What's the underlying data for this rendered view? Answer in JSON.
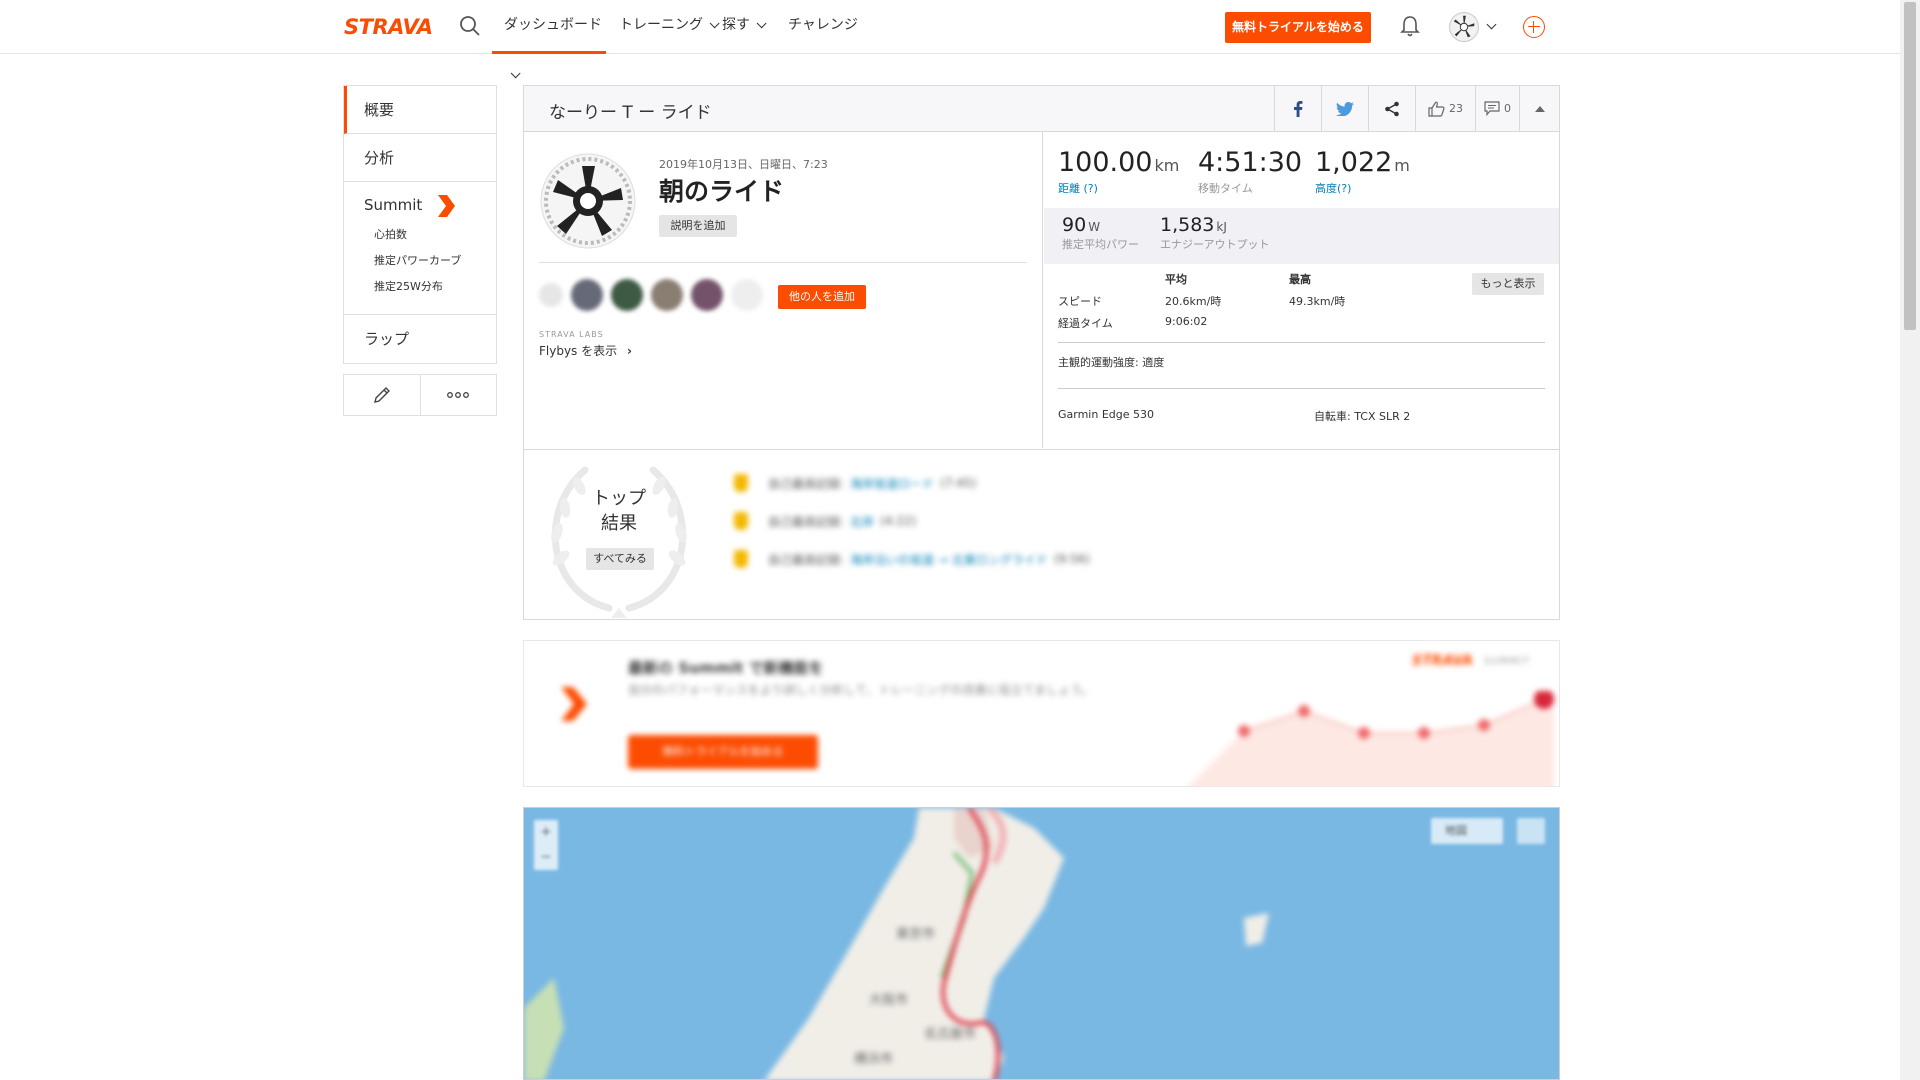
{
  "nav": {
    "logo": "STRAVA",
    "items": [
      {
        "label": "ダッシュボード"
      },
      {
        "label": "トレーニング"
      },
      {
        "label": "探す"
      },
      {
        "label": "チャレンジ"
      }
    ],
    "trial_button": "無料トライアルを始める",
    "accent": "#fc4c02"
  },
  "sidebar": {
    "items": [
      {
        "label": "概要"
      },
      {
        "label": "分析"
      }
    ],
    "summit": {
      "label": "Summit",
      "sub": [
        "心拍数",
        "推定パワーカーブ",
        "推定25W分布"
      ]
    },
    "laps": "ラップ",
    "actions": {
      "edit": "pencil-icon",
      "more": "more-icon"
    }
  },
  "activity": {
    "header_title": "なーりー T ー ライド",
    "kudos_count": "23",
    "comment_count": "0",
    "date": "2019年10月13日、日曜日、7:23",
    "name": "朝のライド",
    "add_description": "説明を追加",
    "add_others": "他の人を追加",
    "labs_label": "STRAVA LABS",
    "flybys": "Flybys を表示"
  },
  "stats": {
    "distance": {
      "value": "100.00",
      "unit": "km",
      "label": "距離 (?)"
    },
    "moving_time": {
      "value": "4:51:30",
      "label": "移動タイム"
    },
    "elevation": {
      "value": "1,022",
      "unit": "m",
      "label": "高度(?)"
    },
    "power": {
      "value": "90",
      "unit": "W",
      "label": "推定平均パワー"
    },
    "energy": {
      "value": "1,583",
      "unit": "kJ",
      "label": "エナジーアウトプット"
    },
    "more_button": "もっと表示",
    "table": {
      "col_avg": "平均",
      "col_max": "最高",
      "speed_label": "スピード",
      "speed_avg": "20.6km/時",
      "speed_max": "49.3km/時",
      "elapsed_label": "経過タイム",
      "elapsed": "9:06:02"
    },
    "rpe": "主観的運動強度: 適度",
    "device": "Garmin Edge 530",
    "bike": "自転車: TCX SLR 2"
  },
  "achievements": {
    "title_line1": "トップ",
    "title_line2": "結果",
    "see_all": "すべてみる",
    "rows": [
      {
        "text": "自己最高記録:",
        "link": "海岸坂道ロード",
        "extra": "(7:45)"
      },
      {
        "text": "自己最高記録:",
        "link": "北岸",
        "extra": "(4:22)"
      },
      {
        "text": "自己最高記録:",
        "link": "海岸沿いの坂道 → 北東ロングライド",
        "extra": "(9:56)"
      }
    ]
  },
  "promo": {
    "headline": "最新の Summit で新機能を",
    "body": "自分のパフォーマンスをより詳しく分析して、トレーニングの改善に役立てましょう。",
    "button": "無料トライアルを始める",
    "brand": "STRAVA",
    "brand2": "SUMMIT"
  },
  "map": {
    "labels": [
      "東京市",
      "大阪市",
      "名古屋市",
      "横浜市"
    ],
    "zoom_plus": "+",
    "zoom_minus": "−",
    "layer_button": "地図"
  }
}
